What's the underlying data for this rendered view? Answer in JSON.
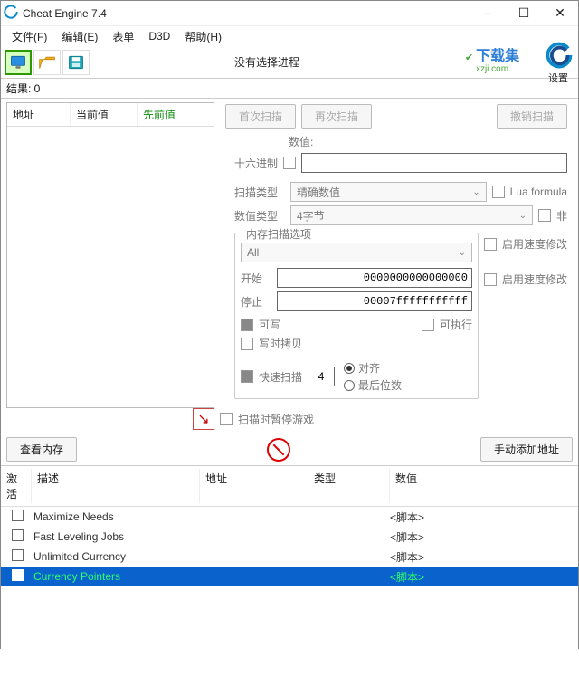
{
  "title": "Cheat Engine 7.4",
  "menu": {
    "file": "文件(F)",
    "edit": "编辑(E)",
    "table": "表单",
    "d3d": "D3D",
    "help": "帮助(H)"
  },
  "toolbar": {
    "no_process": "没有选择进程",
    "settings": "设置"
  },
  "watermark": {
    "brand": "下载集",
    "url": "xzji.com"
  },
  "results_label": "结果: 0",
  "scanlist": {
    "col1": "地址",
    "col2": "当前值",
    "col3": "先前值"
  },
  "scan_buttons": {
    "first": "首次扫描",
    "next": "再次扫描",
    "undo": "撤销扫描"
  },
  "value_label": "数值:",
  "hex_label": "十六进制",
  "scan_type_label": "扫描类型",
  "scan_type_value": "精确数值",
  "value_type_label": "数值类型",
  "value_type_value": "4字节",
  "lua_formula": "Lua formula",
  "not_label": "非",
  "mem_scan_options": "内存扫描选项",
  "mem_region": "All",
  "start_label": "开始",
  "start_value": "0000000000000000",
  "stop_label": "停止",
  "stop_value": "00007fffffffffff",
  "writable": "可写",
  "executable": "可执行",
  "copy_on_write": "写时拷贝",
  "enable_speed1": "启用速度修改",
  "enable_speed2": "启用速度修改",
  "fast_scan": "快速扫描",
  "fast_scan_value": "4",
  "align": "对齐",
  "last_digits": "最后位数",
  "pause_label": "扫描时暂停游戏",
  "view_memory": "查看内存",
  "add_manual": "手动添加地址",
  "ct_headers": {
    "active": "激活",
    "desc": "描述",
    "addr": "地址",
    "type": "类型",
    "value": "数值"
  },
  "ct_rows": [
    {
      "desc": "Maximize Needs",
      "value": "<脚本>"
    },
    {
      "desc": "Fast Leveling Jobs",
      "value": "<脚本>"
    },
    {
      "desc": "Unlimited Currency",
      "value": "<脚本>"
    },
    {
      "desc": "Currency Pointers",
      "value": "<脚本>",
      "selected": true
    }
  ]
}
